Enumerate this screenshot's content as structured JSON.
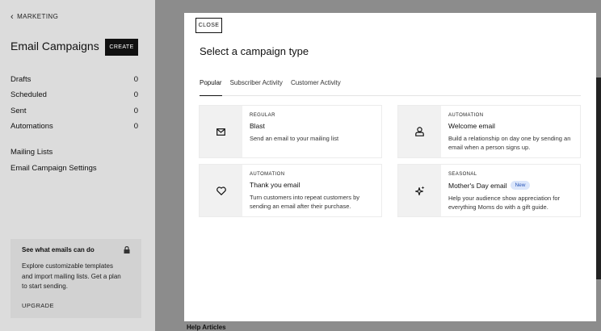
{
  "sidebar": {
    "back_label": "MARKETING",
    "title": "Email Campaigns",
    "create_label": "CREATE",
    "stats": [
      {
        "label": "Drafts",
        "count": "0"
      },
      {
        "label": "Scheduled",
        "count": "0"
      },
      {
        "label": "Sent",
        "count": "0"
      },
      {
        "label": "Automations",
        "count": "0"
      }
    ],
    "links": [
      "Mailing Lists",
      "Email Campaign Settings"
    ],
    "promo": {
      "title": "See what emails can do",
      "text": "Explore customizable templates and import mailing lists. Get a plan to start sending.",
      "link": "UPGRADE"
    }
  },
  "background": {
    "help_articles": "Help Articles"
  },
  "modal": {
    "close_label": "CLOSE",
    "title": "Select a campaign type",
    "tabs": [
      "Popular",
      "Subscriber Activity",
      "Customer Activity"
    ],
    "cards": [
      {
        "kind": "REGULAR",
        "name": "Blast",
        "desc": "Send an email to your mailing list",
        "icon": "mail-icon"
      },
      {
        "kind": "AUTOMATION",
        "name": "Welcome email",
        "desc": "Build a relationship on day one by sending an email when a person signs up.",
        "icon": "person-icon"
      },
      {
        "kind": "AUTOMATION",
        "name": "Thank you email",
        "desc": "Turn customers into repeat customers by sending an email after their purchase.",
        "icon": "heart-icon"
      },
      {
        "kind": "SEASONAL",
        "name": "Mother's Day email",
        "badge": "New",
        "desc": "Help your audience show appreciation for everything Moms do with a gift guide.",
        "icon": "sparkle-icon"
      }
    ]
  }
}
